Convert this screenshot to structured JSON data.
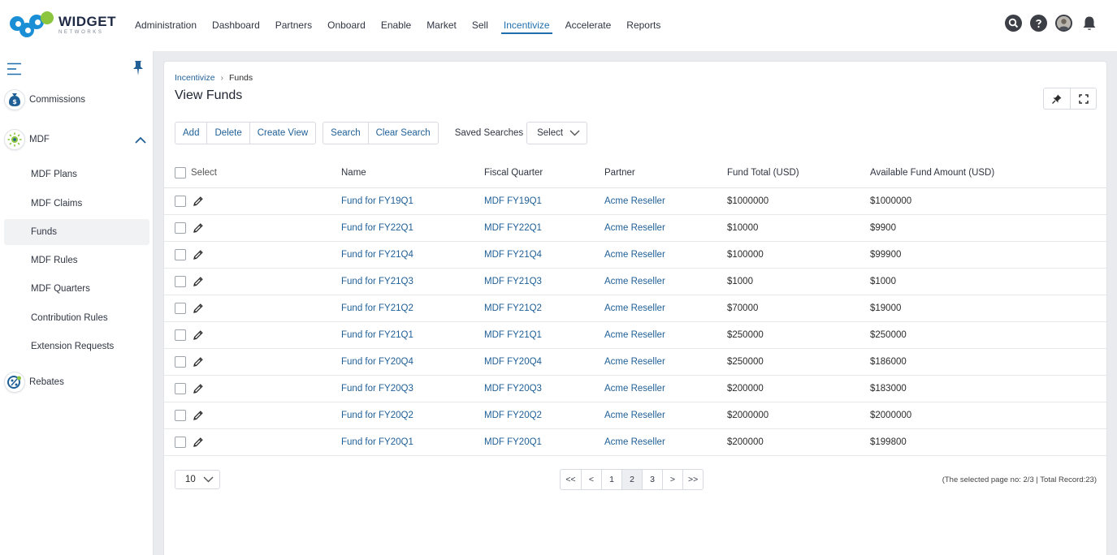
{
  "brand": {
    "name": "WIDGET",
    "tagline": "NETWORKS"
  },
  "nav": {
    "items": [
      "Administration",
      "Dashboard",
      "Partners",
      "Onboard",
      "Enable",
      "Market",
      "Sell",
      "Incentivize",
      "Accelerate",
      "Reports"
    ],
    "active": "Incentivize"
  },
  "sidebar": {
    "groups": {
      "commissions": "Commissions",
      "mdf": "MDF",
      "rebates": "Rebates"
    },
    "mdf_items": [
      "MDF Plans",
      "MDF Claims",
      "Funds",
      "MDF Rules",
      "MDF Quarters",
      "Contribution Rules",
      "Extension Requests"
    ],
    "active_item": "Funds"
  },
  "breadcrumb": {
    "parent": "Incentivize",
    "current": "Funds"
  },
  "page_title": "View Funds",
  "toolbar": {
    "add": "Add",
    "delete": "Delete",
    "create_view": "Create View",
    "search": "Search",
    "clear_search": "Clear Search",
    "saved_searches_label": "Saved Searches",
    "saved_searches_value": "Select"
  },
  "table": {
    "headers": {
      "select": "Select",
      "name": "Name",
      "fiscal_quarter": "Fiscal Quarter",
      "partner": "Partner",
      "fund_total": "Fund Total (USD)",
      "available": "Available Fund Amount (USD)"
    },
    "rows": [
      {
        "name": "Fund for FY19Q1",
        "fq": "MDF FY19Q1",
        "partner": "Acme Reseller",
        "total": "$1000000",
        "available": "$1000000"
      },
      {
        "name": "Fund for FY22Q1",
        "fq": "MDF FY22Q1",
        "partner": "Acme Reseller",
        "total": "$10000",
        "available": "$9900"
      },
      {
        "name": "Fund for FY21Q4",
        "fq": "MDF FY21Q4",
        "partner": "Acme Reseller",
        "total": "$100000",
        "available": "$99900"
      },
      {
        "name": "Fund for FY21Q3",
        "fq": "MDF FY21Q3",
        "partner": "Acme Reseller",
        "total": "$1000",
        "available": "$1000"
      },
      {
        "name": "Fund for FY21Q2",
        "fq": "MDF FY21Q2",
        "partner": "Acme Reseller",
        "total": "$70000",
        "available": "$19000"
      },
      {
        "name": "Fund for FY21Q1",
        "fq": "MDF FY21Q1",
        "partner": "Acme Reseller",
        "total": "$250000",
        "available": "$250000"
      },
      {
        "name": "Fund for FY20Q4",
        "fq": "MDF FY20Q4",
        "partner": "Acme Reseller",
        "total": "$250000",
        "available": "$186000"
      },
      {
        "name": "Fund for FY20Q3",
        "fq": "MDF FY20Q3",
        "partner": "Acme Reseller",
        "total": "$200000",
        "available": "$183000"
      },
      {
        "name": "Fund for FY20Q2",
        "fq": "MDF FY20Q2",
        "partner": "Acme Reseller",
        "total": "$2000000",
        "available": "$2000000"
      },
      {
        "name": "Fund for FY20Q1",
        "fq": "MDF FY20Q1",
        "partner": "Acme Reseller",
        "total": "$200000",
        "available": "$199800"
      }
    ]
  },
  "pagination": {
    "page_size": "10",
    "buttons": [
      "<<",
      "<",
      "1",
      "2",
      "3",
      ">",
      ">>"
    ],
    "active_page": "2",
    "record_info": "(The selected page no: 2/3 | Total Record:23)"
  },
  "colors": {
    "link": "#1f5f96",
    "active_nav": "#1f6fae",
    "logo_blue": "#1a8fd6",
    "logo_green": "#8cc63f"
  }
}
